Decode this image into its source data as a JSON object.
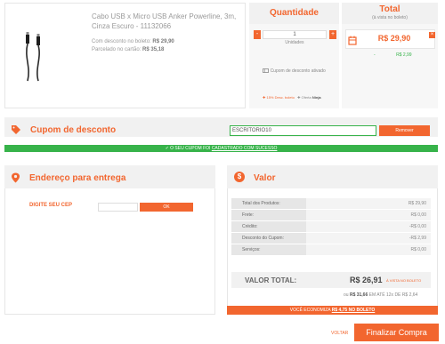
{
  "product": {
    "name": "Cabo USB x Micro USB Anker Powerline, 3m, Cinza Escuro - 11132066",
    "boleto_label": "Com desconto no boleto:",
    "boleto_price": "R$ 29,90",
    "card_label": "Parcelado no cartão:",
    "card_price": "R$ 35,18"
  },
  "quantity": {
    "header": "Quantidade",
    "minus": "-",
    "plus": "+",
    "value": "1",
    "units_label": "Unidades",
    "coupon_active": "Cupom de desconto ativado",
    "discount_note": "15% Desc. boleto",
    "offer_prefix": "Oferta",
    "offer_name": "Ninja"
  },
  "total": {
    "header": "Total",
    "subheader": "(à vista no boleto)",
    "price": "R$ 29,90",
    "delete": "×",
    "sub_sign": "-",
    "sub_price": "R$ 2,99"
  },
  "coupon": {
    "title": "Cupom de desconto",
    "code": "ESCRITORIO10",
    "remove_label": "Remover",
    "success_prefix": "✓ O SEU CUPOM FOI",
    "success_text": "CADASTRADO COM SUCESSO"
  },
  "address": {
    "title": "Endereço para entrega",
    "cep_label": "DIGITE SEU CEP",
    "cep_value": "",
    "ok_label": "OK"
  },
  "valor": {
    "title": "Valor",
    "rows": [
      {
        "label": "Total dos Produtos:",
        "value": "R$ 29,90"
      },
      {
        "label": "Frete:",
        "value": "R$ 0,00"
      },
      {
        "label": "Crédito:",
        "value": "-R$ 0,00"
      },
      {
        "label": "Desconto do Cupom:",
        "value": "-R$ 2,99"
      },
      {
        "label": "Serviços:",
        "value": "R$ 0,00"
      }
    ],
    "total_label": "VALOR TOTAL:",
    "total_price": "R$ 26,91",
    "total_note": "À VISTA NO BOLETO",
    "installments_prefix": "ou",
    "installments_price": "R$ 31,66",
    "installments_suffix": "EM ATÉ 12x DE R$ 2,64",
    "savings_prefix": "VOCÊ ECONOMIZA",
    "savings_value": "R$ 4,75 NO BOLETO"
  },
  "footer": {
    "back_label": "VOLTAR",
    "checkout_label": "Finalizar Compra"
  },
  "colors": {
    "accent": "#f2662f",
    "success": "#37b34a",
    "panel": "#f1f1f1"
  },
  "icons": [
    "cable-icon",
    "cart-icon",
    "ticket-icon",
    "tag-icon",
    "map-pin-icon",
    "dollar-icon"
  ]
}
